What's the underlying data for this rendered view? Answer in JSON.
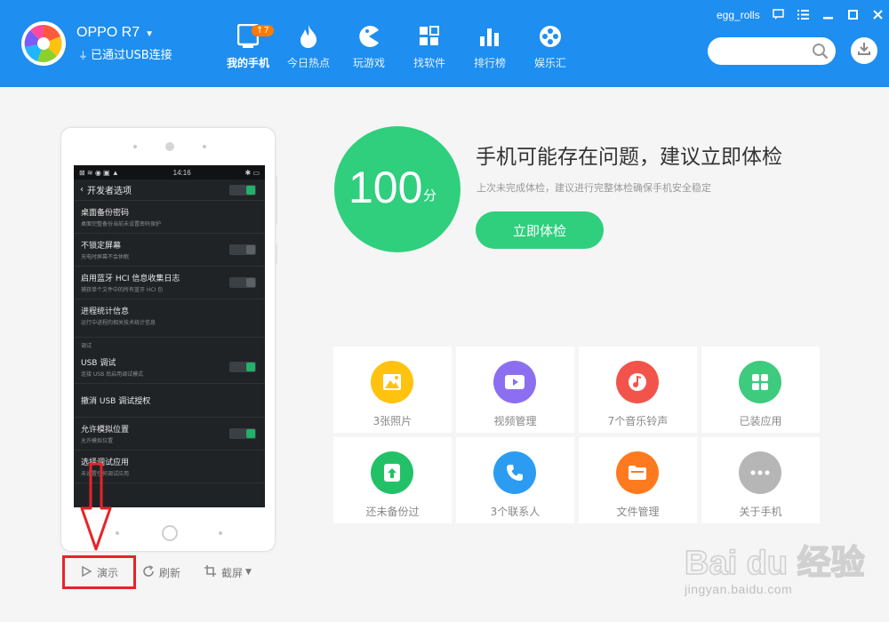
{
  "header": {
    "device_name": "OPPO R7",
    "usb_status": "已通过USB连接",
    "user": "egg_rolls",
    "search_placeholder": ""
  },
  "nav": {
    "items": [
      {
        "label": "我的手机",
        "icon": "phone-icon",
        "badge": "7"
      },
      {
        "label": "今日热点",
        "icon": "flame-icon"
      },
      {
        "label": "玩游戏",
        "icon": "game-icon"
      },
      {
        "label": "找软件",
        "icon": "apps-icon"
      },
      {
        "label": "排行榜",
        "icon": "ranking-icon"
      },
      {
        "label": "娱乐汇",
        "icon": "film-reel-icon"
      }
    ]
  },
  "phone_screen": {
    "time": "14:16",
    "title": "开发者选项",
    "rows": [
      {
        "title": "桌面备份密码",
        "sub": "桌面完整备份当前未设置密码保护"
      },
      {
        "title": "不锁定屏幕",
        "sub": "充电时屏幕不会休眠"
      },
      {
        "title": "启用蓝牙 HCI 信息收集日志",
        "sub": "捕获单个文件中的所有蓝牙 HCI 包"
      },
      {
        "title": "进程统计信息",
        "sub": "运行中进程的相关技术统计信息"
      },
      {
        "title": "USB 调试",
        "sub": "连接 USB 后启用调试模式"
      },
      {
        "title": "撤消 USB 调试授权",
        "sub": ""
      },
      {
        "title": "允许模拟位置",
        "sub": "允许模拟位置"
      },
      {
        "title": "选择调试应用",
        "sub": "未设置任何调试应用"
      }
    ],
    "section_label": "调试"
  },
  "phone_controls": {
    "demo": "演示",
    "refresh": "刷新",
    "screenshot": "截屏"
  },
  "check": {
    "score": "100",
    "unit": "分",
    "headline": "手机可能存在问题，建议立即体检",
    "subline": "上次未完成体检，建议进行完整体检确保手机安全稳定",
    "button": "立即体检"
  },
  "tiles": [
    {
      "label": "3张照片",
      "icon": "photo-icon",
      "color": "#ffc20e"
    },
    {
      "label": "视频管理",
      "icon": "video-icon",
      "color": "#8c6ff0"
    },
    {
      "label": "7个音乐铃声",
      "icon": "music-icon",
      "color": "#f2544c"
    },
    {
      "label": "已装应用",
      "icon": "installed-apps-icon",
      "color": "#3ecb7e"
    },
    {
      "label": "还未备份过",
      "icon": "backup-icon",
      "color": "#22c168"
    },
    {
      "label": "3个联系人",
      "icon": "contacts-icon",
      "color": "#2b9cf2"
    },
    {
      "label": "文件管理",
      "icon": "folder-icon",
      "color": "#ff7a1e"
    },
    {
      "label": "关于手机",
      "icon": "more-icon",
      "color": "#b6b6b6"
    }
  ],
  "watermark": {
    "text": "Bai du 经验",
    "url": "jingyan.baidu.com"
  },
  "colors": {
    "topbar": "#1e8ef0",
    "accent_green": "#2fcf7d",
    "highlight_red": "#e8232a"
  }
}
